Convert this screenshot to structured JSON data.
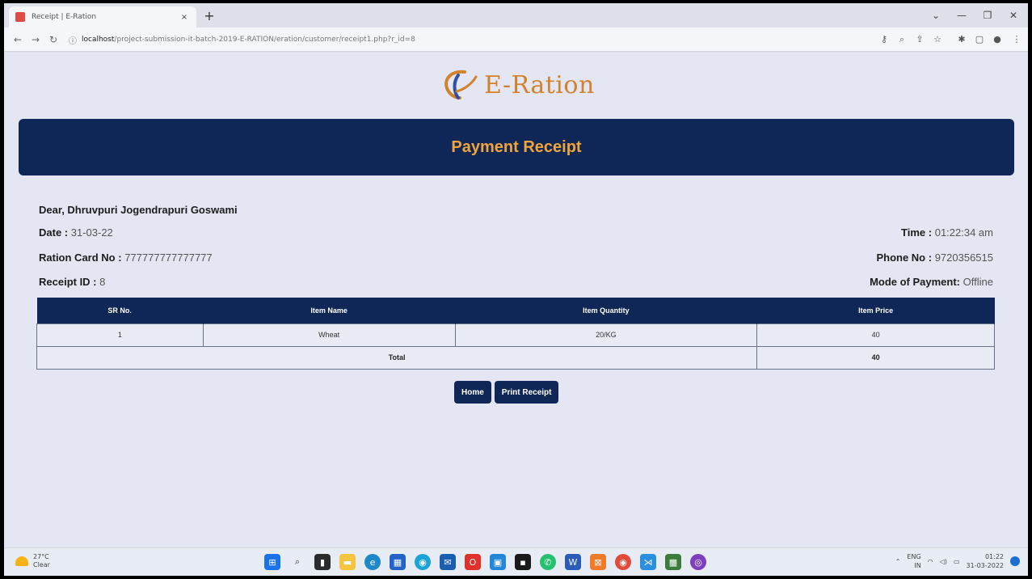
{
  "browser": {
    "tab_title": "Receipt | E-Ration",
    "tab_close": "×",
    "new_tab": "+",
    "url_host": "localhost",
    "url_path": "/project-submission-it-batch-2019-E-RATION/eration/customer/receipt1.php?r_id=8",
    "window_controls": [
      "⌄",
      "—",
      "❐",
      "✕"
    ]
  },
  "logo": {
    "text": "E-Ration"
  },
  "banner": {
    "title": "Payment Receipt"
  },
  "receipt": {
    "greeting": "Dear, Dhruvpuri Jogendrapuri Goswami",
    "date_label": "Date :",
    "date_value": "31-03-22",
    "time_label": "Time :",
    "time_value": "01:22:34 am",
    "ration_label": "Ration Card No :",
    "ration_value": "777777777777777",
    "phone_label": "Phone No :",
    "phone_value": "9720356515",
    "receipt_label": "Receipt ID :",
    "receipt_value": "8",
    "mode_label": "Mode of Payment:",
    "mode_value": "Offline"
  },
  "table": {
    "headers": [
      "SR No.",
      "Item Name",
      "Item Quantity",
      "Item Price"
    ],
    "rows": [
      [
        "1",
        "Wheat",
        "20/KG",
        "40"
      ]
    ],
    "total_label": "Total",
    "total_value": "40"
  },
  "buttons": {
    "home": "Home",
    "print": "Print Receipt"
  },
  "taskbar": {
    "temperature": "27°C",
    "weather": "Clear",
    "lang": "ENG",
    "region": "IN",
    "time": "01:22",
    "date": "31-03-2022"
  },
  "colors": {
    "navy": "#0f2757",
    "accent": "#f0a43a",
    "logo": "#d2822b"
  }
}
